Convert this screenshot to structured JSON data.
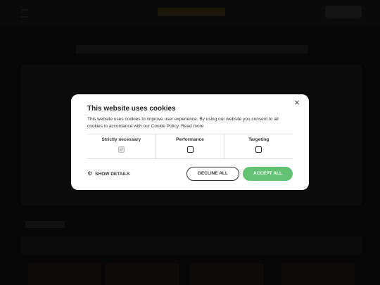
{
  "modal": {
    "title": "This website uses cookies",
    "description": "This website uses cookies to improve user experience. By using our website you consent to all cookies in accordance with our Cookie Policy.",
    "read_more": "Read more",
    "close_glyph": "×",
    "categories": [
      {
        "label": "Strictly necessary",
        "checked": true,
        "disabled": true
      },
      {
        "label": "Performance",
        "checked": false,
        "disabled": false
      },
      {
        "label": "Targeting",
        "checked": false,
        "disabled": false
      }
    ],
    "show_details": "SHOW DETAILS",
    "decline_label": "DECLINE ALL",
    "accept_label": "ACCEPT ALL",
    "gear_icon": "gear-icon"
  },
  "colors": {
    "accept": "#63c174",
    "overlay": "rgba(0,0,0,0.35)"
  }
}
